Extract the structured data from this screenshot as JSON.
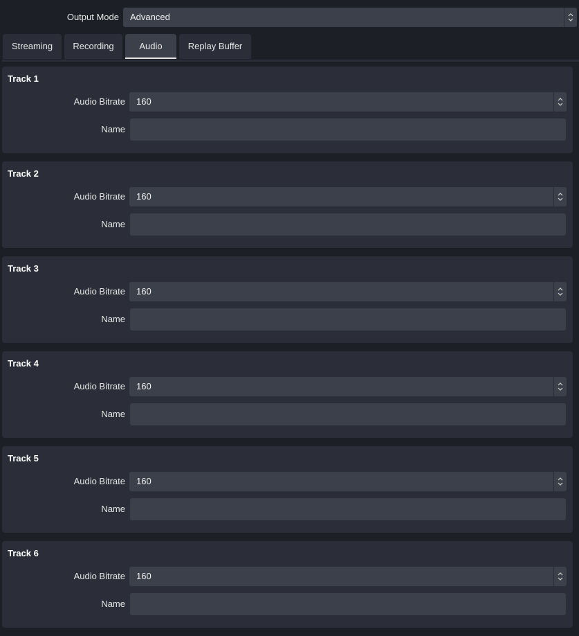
{
  "output_mode": {
    "label": "Output Mode",
    "value": "Advanced"
  },
  "tabs": [
    {
      "label": "Streaming"
    },
    {
      "label": "Recording"
    },
    {
      "label": "Audio"
    },
    {
      "label": "Replay Buffer"
    }
  ],
  "active_tab": "Audio",
  "tracks": [
    {
      "title": "Track 1",
      "bitrate_label": "Audio Bitrate",
      "bitrate": "160",
      "name_label": "Name",
      "name": ""
    },
    {
      "title": "Track 2",
      "bitrate_label": "Audio Bitrate",
      "bitrate": "160",
      "name_label": "Name",
      "name": ""
    },
    {
      "title": "Track 3",
      "bitrate_label": "Audio Bitrate",
      "bitrate": "160",
      "name_label": "Name",
      "name": ""
    },
    {
      "title": "Track 4",
      "bitrate_label": "Audio Bitrate",
      "bitrate": "160",
      "name_label": "Name",
      "name": ""
    },
    {
      "title": "Track 5",
      "bitrate_label": "Audio Bitrate",
      "bitrate": "160",
      "name_label": "Name",
      "name": ""
    },
    {
      "title": "Track 6",
      "bitrate_label": "Audio Bitrate",
      "bitrate": "160",
      "name_label": "Name",
      "name": ""
    }
  ],
  "colors": {
    "background": "#1d1f26",
    "panel": "#2b2e38",
    "field": "#3c404b",
    "active_tab_underline": "#e4e4e4"
  },
  "icons": {
    "spin": "up-down-spin-arrows-icon"
  }
}
